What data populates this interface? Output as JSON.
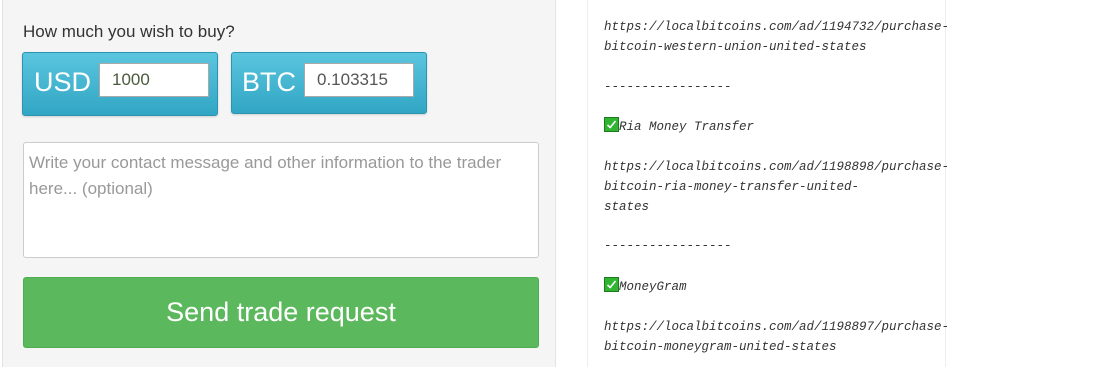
{
  "form": {
    "question": "How much you wish to buy?",
    "usd_label": "USD",
    "usd_value": "1000",
    "btc_label": "BTC",
    "btc_value": "0.103315",
    "message_placeholder": "Write your contact message and other information to the trader here... (optional)",
    "send_label": "Send trade request"
  },
  "ad_text": {
    "line_1": "https://localbitcoins.com/ad/1194732/purchase-",
    "line_2": "bitcoin-western-union-united-states",
    "divider_1": "-----------------",
    "method_1": "Ria Money Transfer",
    "line_3": "https://localbitcoins.com/ad/1198898/purchase-",
    "line_4": "bitcoin-ria-money-transfer-united-",
    "line_5": "states",
    "divider_2": "-----------------",
    "method_2": "MoneyGram",
    "line_6": "https://localbitcoins.com/ad/1198897/purchase-",
    "line_7": "bitcoin-moneygram-united-states",
    "check_icon": "check-mark-icon"
  }
}
